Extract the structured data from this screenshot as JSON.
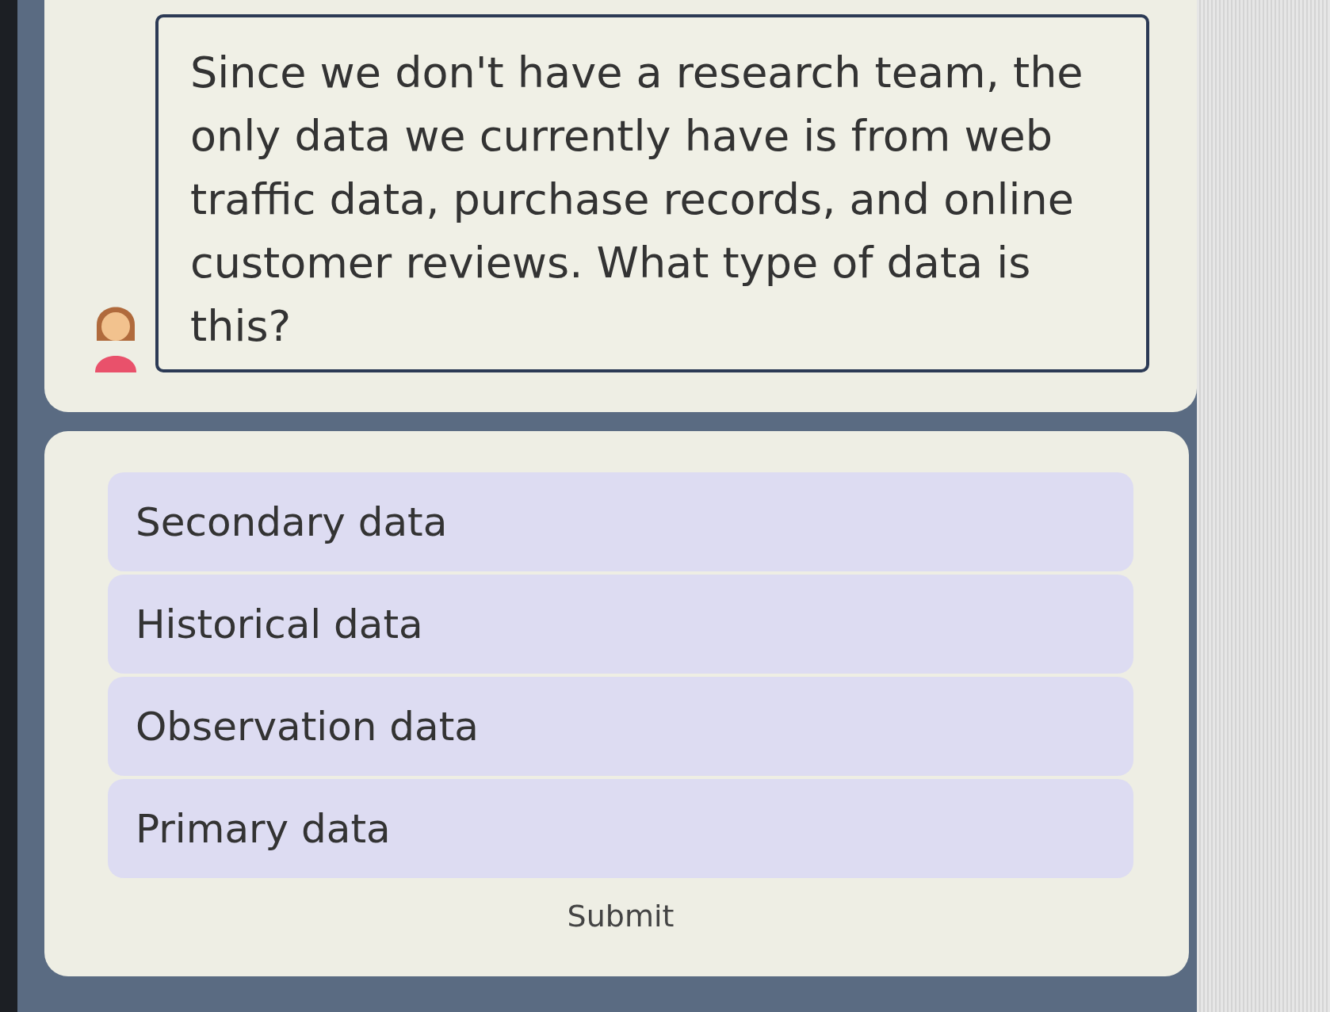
{
  "message": {
    "text": "Since we don't have a research team, the only data we currently have is from web traffic data, purchase records, and online customer reviews. What type of data is this?"
  },
  "options": [
    {
      "label": "Secondary data",
      "selected": false
    },
    {
      "label": "Historical data",
      "selected": false
    },
    {
      "label": "Observation data",
      "selected": false
    },
    {
      "label": "Primary data",
      "selected": false
    }
  ],
  "submit": {
    "label": "Submit"
  }
}
